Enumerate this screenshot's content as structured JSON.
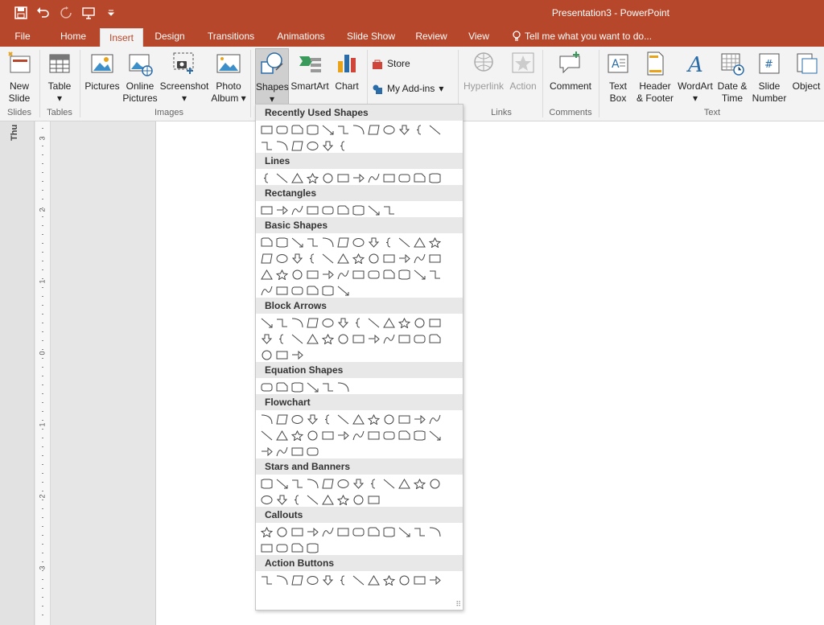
{
  "window": {
    "title": "Presentation3 - PowerPoint"
  },
  "qat": [
    "save-icon",
    "undo-icon",
    "redo-icon",
    "present-icon",
    "customize-icon"
  ],
  "tabs": [
    "File",
    "Home",
    "Insert",
    "Design",
    "Transitions",
    "Animations",
    "Slide Show",
    "Review",
    "View"
  ],
  "active_tab": "Insert",
  "tell_me": "Tell me what you want to do...",
  "ribbon": {
    "new_slide": [
      "New",
      "Slide"
    ],
    "table": "Table",
    "pictures": "Pictures",
    "online_pictures": [
      "Online",
      "Pictures"
    ],
    "screenshot": "Screenshot",
    "photo_album": [
      "Photo",
      "Album"
    ],
    "shapes": "Shapes",
    "smartart": "SmartArt",
    "chart": "Chart",
    "store": "Store",
    "my_addins": "My Add-ins",
    "hyperlink": "Hyperlink",
    "action": "Action",
    "comment": "Comment",
    "text_box": [
      "Text",
      "Box"
    ],
    "header_footer": [
      "Header",
      "& Footer"
    ],
    "wordart": "WordArt",
    "date_time": [
      "Date &",
      "Time"
    ],
    "slide_number": [
      "Slide",
      "Number"
    ],
    "object": "Object",
    "groups": {
      "slides": "Slides",
      "tables": "Tables",
      "images": "Images",
      "links": "Links",
      "comments": "Comments",
      "text": "Text"
    }
  },
  "thumb_label": "Thu",
  "ruler_labels": [
    "3",
    "2",
    "1",
    "0",
    "1",
    "2",
    "3"
  ],
  "gallery": {
    "sections": [
      {
        "title": "Recently Used Shapes",
        "rows": [
          12,
          6
        ]
      },
      {
        "title": "Lines",
        "rows": [
          12
        ]
      },
      {
        "title": "Rectangles",
        "rows": [
          9
        ]
      },
      {
        "title": "Basic Shapes",
        "rows": [
          12,
          12,
          12,
          6
        ]
      },
      {
        "title": "Block Arrows",
        "rows": [
          12,
          12,
          3
        ]
      },
      {
        "title": "Equation Shapes",
        "rows": [
          6
        ]
      },
      {
        "title": "Flowchart",
        "rows": [
          12,
          12,
          4
        ]
      },
      {
        "title": "Stars and Banners",
        "rows": [
          12,
          8
        ]
      },
      {
        "title": "Callouts",
        "rows": [
          12,
          4
        ]
      },
      {
        "title": "Action Buttons",
        "rows": [
          12
        ]
      }
    ]
  }
}
